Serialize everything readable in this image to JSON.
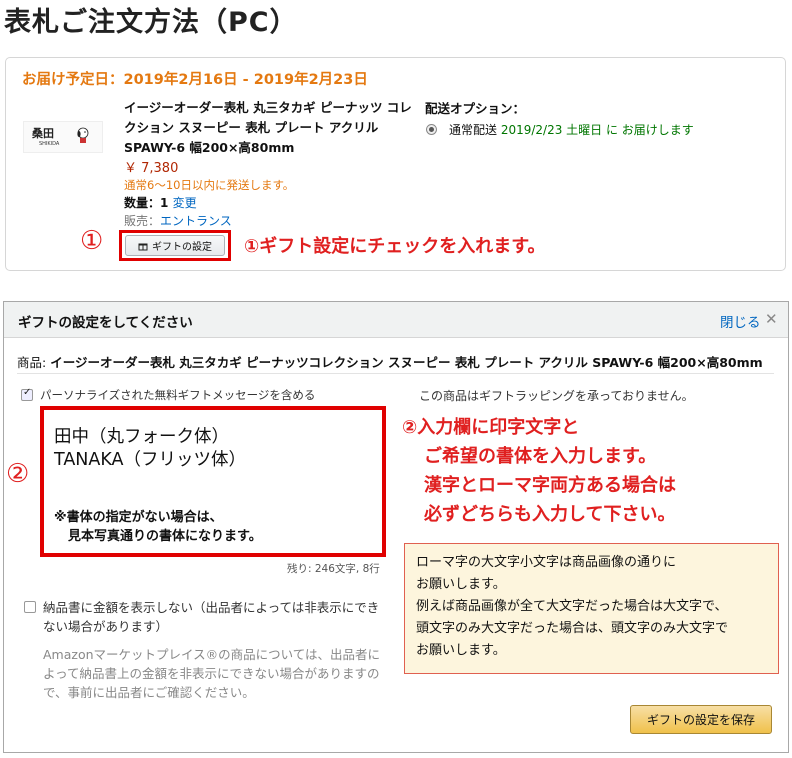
{
  "page": {
    "title": "表札ご注文方法（PC）"
  },
  "order": {
    "delivery_estimate": "お届け予定日：2019年2月16日 - 2019年2月23日",
    "thumbnail": {
      "kanji": "桑田",
      "romaji": "SHIKIDA"
    },
    "product_name": "イージーオーダー表札 丸三タカギ ピーナッツ コレクション スヌーピー 表札 プレート アクリル SPAWY-6 幅200×高80mm",
    "price": "￥ 7,380",
    "ship_note": "通常6～10日以内に発送します。",
    "quantity_label": "数量：",
    "quantity_value": "1",
    "change_label": "変更",
    "seller_label": "販売：",
    "seller_name": "エントランス",
    "shipping": {
      "label": "配送オプション：",
      "option_prefix": "通常配送 ",
      "option_highlight": "2019/2/23 土曜日 に お届けします"
    },
    "gift_button_label": "ギフトの設定",
    "annotation_marker": "①",
    "annotation_text": "①ギフト設定にチェックを入れます。"
  },
  "gift_modal": {
    "title": "ギフトの設定をしてください",
    "close_label": "閉じる",
    "product_prefix": "商品: ",
    "product_name": "イージーオーダー表札 丸三タカギ ピーナッツコレクション スヌーピー 表札 プレート アクリル SPAWY-6 幅200×高80mm",
    "include_message_label": "パーソナライズされた無料ギフトメッセージを含める",
    "include_message_checked": true,
    "no_wrapping_note": "この商品はギフトラッピングを承っておりません。",
    "message": {
      "line1": "田中（丸フォーク体）",
      "line2": "TANAKA（フリッツ体）",
      "note1": "※書体の指定がない場合は、",
      "note2": "見本写真通りの書体になります。"
    },
    "annotation_marker": "②",
    "remaining": "残り: 246文字, 8行",
    "annotation_lines": [
      "②入力欄に印字文字と",
      "ご希望の書体を入力します。",
      "漢字とローマ字両方ある場合は",
      "必ずどちらも入力して下さい。"
    ],
    "hide_price_label": "納品書に金額を表示しない（出品者によっては非表示にできない場合があります）",
    "hide_price_checked": false,
    "marketplace_note": "Amazonマーケットプレイス®の商品については、出品者によって納品書上の金額を非表示にできない場合がありますので、事前に出品者にご確認ください。",
    "note_lines": [
      "ローマ字の大文字小文字は商品画像の通りに",
      "お願いします。",
      "例えば商品画像が全て大文字だった場合は大文字で、",
      "頭文字のみ大文字だった場合は、頭文字のみ大文字で",
      "お願いします。"
    ],
    "save_label": "ギフトの設定を保存"
  },
  "colors": {
    "delivery_orange": "#e47911",
    "annotation_red": "#e02020",
    "link_blue": "#0066c0",
    "ship_green": "#007600",
    "price_red": "#b12704",
    "note_bg": "#fdf5dd",
    "save_button": "#f0c14b"
  }
}
